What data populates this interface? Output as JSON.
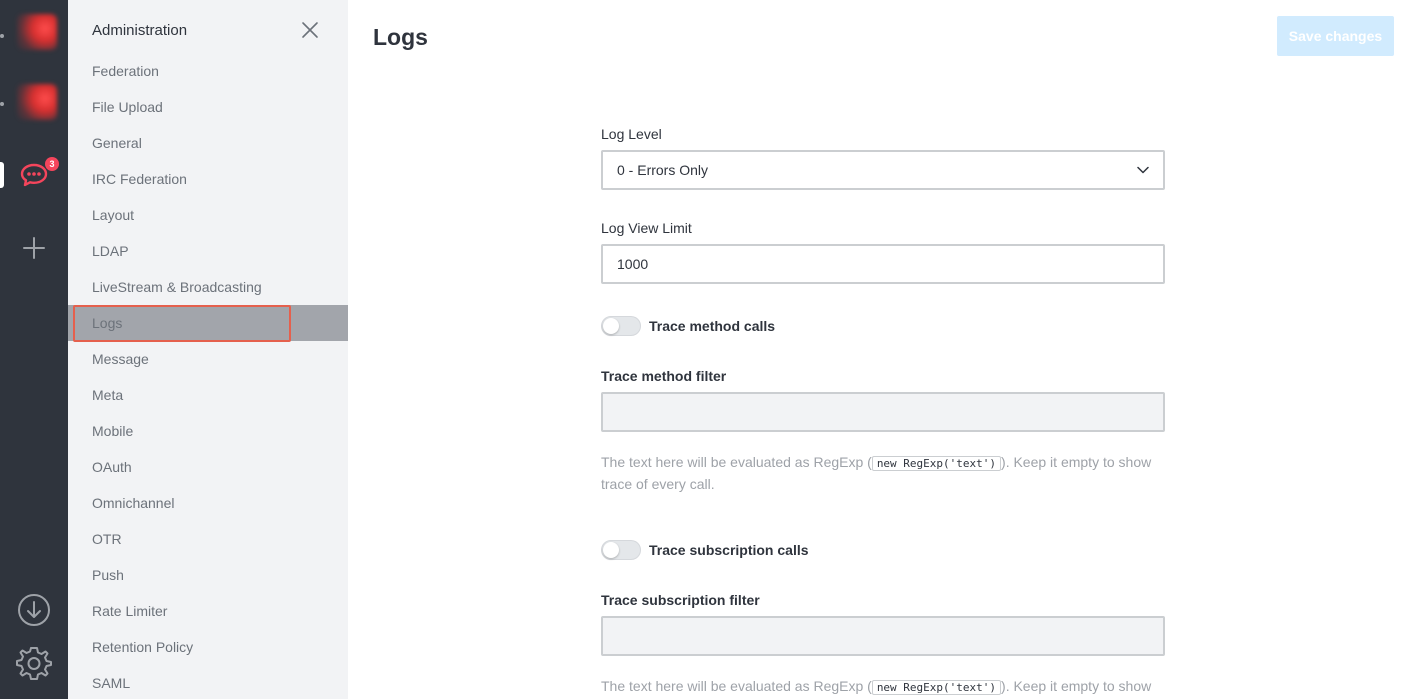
{
  "rail": {
    "badge_count": "3",
    "icons": [
      "workspace-avatar",
      "workspace-avatar",
      "chat-icon",
      "plus-icon",
      "download-icon",
      "gear-icon"
    ]
  },
  "sidebar": {
    "heading": "Administration",
    "items": [
      {
        "label": "Federation"
      },
      {
        "label": "File Upload"
      },
      {
        "label": "General"
      },
      {
        "label": "IRC Federation"
      },
      {
        "label": "Layout"
      },
      {
        "label": "LDAP"
      },
      {
        "label": "LiveStream & Broadcasting"
      },
      {
        "label": "Logs",
        "active": true
      },
      {
        "label": "Message"
      },
      {
        "label": "Meta"
      },
      {
        "label": "Mobile"
      },
      {
        "label": "OAuth"
      },
      {
        "label": "Omnichannel"
      },
      {
        "label": "OTR"
      },
      {
        "label": "Push"
      },
      {
        "label": "Rate Limiter"
      },
      {
        "label": "Retention Policy"
      },
      {
        "label": "SAML"
      }
    ]
  },
  "main": {
    "title": "Logs",
    "save_label": "Save changes",
    "log_level": {
      "label": "Log Level",
      "value": "0 - Errors Only"
    },
    "log_view_limit": {
      "label": "Log View Limit",
      "value": "1000"
    },
    "trace_method_calls": {
      "label": "Trace method calls",
      "enabled": false
    },
    "trace_method_filter": {
      "label": "Trace method filter",
      "value": "",
      "hint_before": "The text here will be evaluated as RegExp (",
      "hint_code": "new RegExp('text')",
      "hint_after": "). Keep it empty to show trace of every call."
    },
    "trace_subscription_calls": {
      "label": "Trace subscription calls",
      "enabled": false
    },
    "trace_subscription_filter": {
      "label": "Trace subscription filter",
      "value": "",
      "hint_before": "The text here will be evaluated as RegExp (",
      "hint_code": "new RegExp('text')",
      "hint_after": "). Keep it empty to show"
    }
  },
  "colors": {
    "rail_bg": "#2f343d",
    "sidebar_bg": "#f2f3f5",
    "active_item_bg": "#a2a5ab",
    "highlight_border": "#e5604d",
    "badge": "#f5455c",
    "save_button_disabled": "#d1ebfe"
  }
}
